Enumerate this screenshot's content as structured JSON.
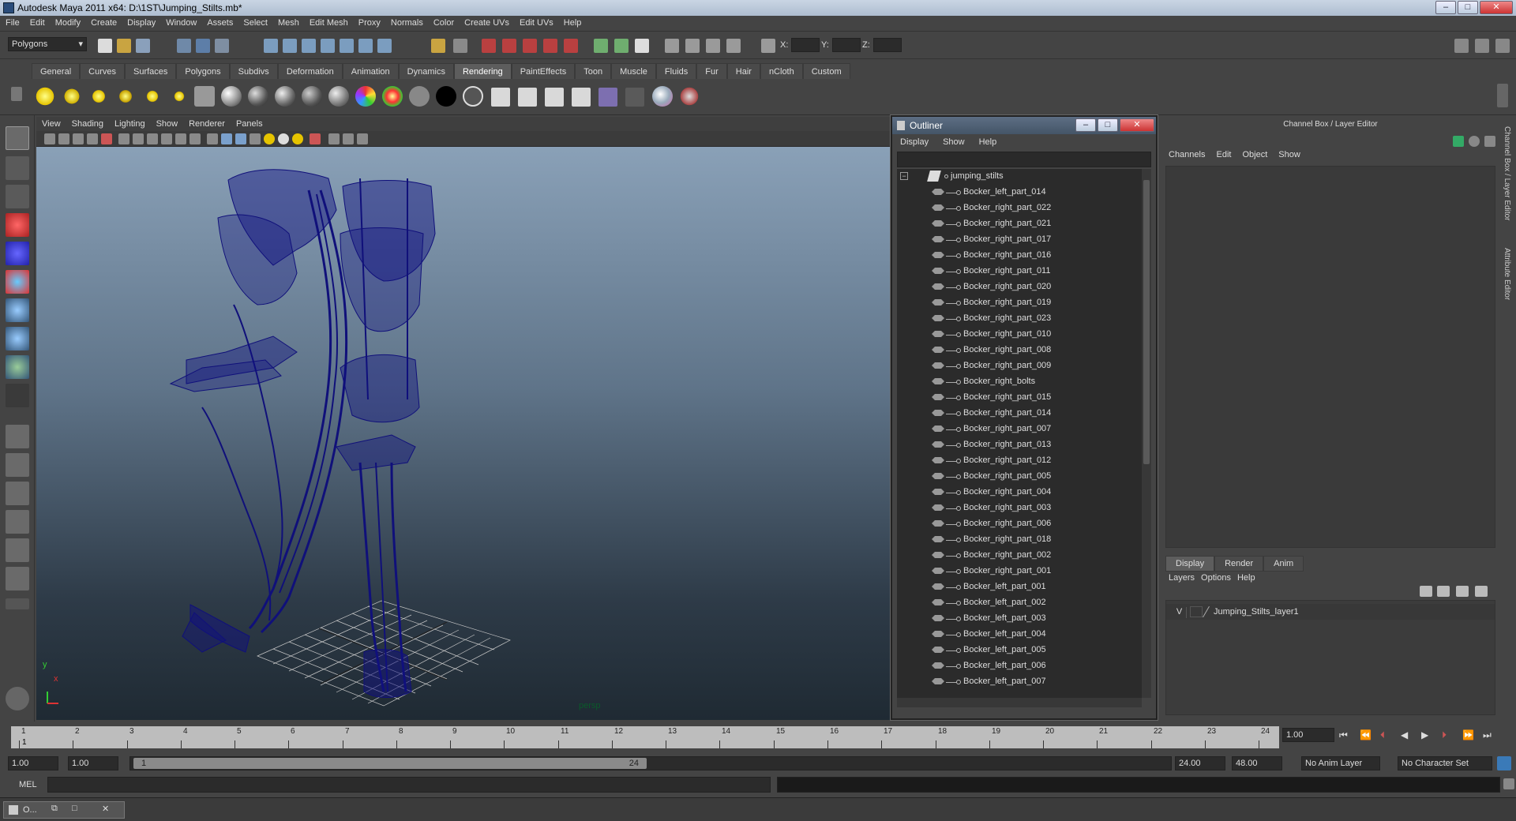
{
  "window": {
    "title": "Autodesk Maya 2011 x64: D:\\1ST\\Jumping_Stilts.mb*",
    "controls": [
      "–",
      "□",
      "✕"
    ]
  },
  "menubar": [
    "File",
    "Edit",
    "Modify",
    "Create",
    "Display",
    "Window",
    "Assets",
    "Select",
    "Mesh",
    "Edit Mesh",
    "Proxy",
    "Normals",
    "Color",
    "Create UVs",
    "Edit UVs",
    "Help"
  ],
  "statusline": {
    "mode": "Polygons",
    "coord_labels": [
      "X:",
      "Y:",
      "Z:"
    ]
  },
  "shelf": {
    "tabs": [
      "General",
      "Curves",
      "Surfaces",
      "Polygons",
      "Subdivs",
      "Deformation",
      "Animation",
      "Dynamics",
      "Rendering",
      "PaintEffects",
      "Toon",
      "Muscle",
      "Fluids",
      "Fur",
      "Hair",
      "nCloth",
      "Custom"
    ],
    "active_tab": "Rendering"
  },
  "viewport": {
    "menu": [
      "View",
      "Shading",
      "Lighting",
      "Show",
      "Renderer",
      "Panels"
    ],
    "camera_label": "persp",
    "axis_x": "x",
    "axis_y": "y"
  },
  "outliner": {
    "title": "Outliner",
    "menu": [
      "Display",
      "Show",
      "Help"
    ],
    "root": "jumping_stilts",
    "items": [
      "Bocker_left_part_014",
      "Bocker_right_part_022",
      "Bocker_right_part_021",
      "Bocker_right_part_017",
      "Bocker_right_part_016",
      "Bocker_right_part_011",
      "Bocker_right_part_020",
      "Bocker_right_part_019",
      "Bocker_right_part_023",
      "Bocker_right_part_010",
      "Bocker_right_part_008",
      "Bocker_right_part_009",
      "Bocker_right_bolts",
      "Bocker_right_part_015",
      "Bocker_right_part_014",
      "Bocker_right_part_007",
      "Bocker_right_part_013",
      "Bocker_right_part_012",
      "Bocker_right_part_005",
      "Bocker_right_part_004",
      "Bocker_right_part_003",
      "Bocker_right_part_006",
      "Bocker_right_part_018",
      "Bocker_right_part_002",
      "Bocker_right_part_001",
      "Bocker_left_part_001",
      "Bocker_left_part_002",
      "Bocker_left_part_003",
      "Bocker_left_part_004",
      "Bocker_left_part_005",
      "Bocker_left_part_006",
      "Bocker_left_part_007"
    ]
  },
  "channelbox": {
    "title": "Channel Box / Layer Editor",
    "menu": [
      "Channels",
      "Edit",
      "Object",
      "Show"
    ],
    "layer_tabs": [
      "Display",
      "Render",
      "Anim"
    ],
    "active_layer_tab": "Display",
    "layer_menu": [
      "Layers",
      "Options",
      "Help"
    ],
    "layer": {
      "visibility": "V",
      "name": "Jumping_Stilts_layer1"
    },
    "side_tabs": [
      "Channel Box / Layer Editor",
      "Attribute Editor"
    ]
  },
  "timeline": {
    "ticks": [
      "1",
      "2",
      "3",
      "4",
      "5",
      "6",
      "7",
      "8",
      "9",
      "10",
      "11",
      "12",
      "13",
      "14",
      "15",
      "16",
      "17",
      "18",
      "19",
      "20",
      "21",
      "22",
      "23",
      "24"
    ],
    "current_frame_marker": "1",
    "current_time": "1.00"
  },
  "range": {
    "start_time": "1.00",
    "playback_start": "1.00",
    "range_start_label": "1",
    "range_end_label": "24",
    "playback_end": "24.00",
    "end_time": "48.00",
    "anim_layer": "No Anim Layer",
    "character_set": "No Character Set"
  },
  "cmdline": {
    "label": "MEL"
  },
  "taskbar": {
    "item": "O..."
  },
  "colors": {
    "wireframe": "#0d0d6e",
    "accent": "#5d6e84"
  }
}
